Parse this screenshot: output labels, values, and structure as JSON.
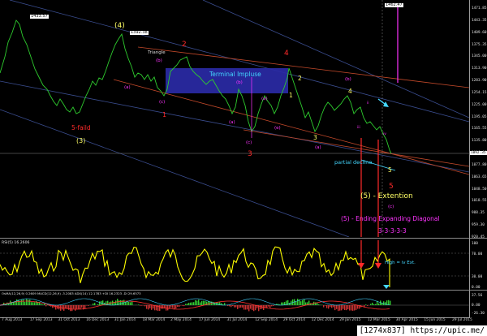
{
  "header": {
    "symbol": "GOLD,Daily",
    "ohlc": "1103.05 1106.34 1091.55 1092.35",
    "rsi_label": "RSI(5) 16.2606",
    "osc_label": "OsMA(12,26,9) 0.2609  MACD(12,26,9)  -3.2083  ADX(14) 12.1783  +DI 16.2323  -DI 29.6573"
  },
  "price_boxes": {
    "p1": "1433.57",
    "p2": "1392.38",
    "p3": "1462.47"
  },
  "annotations": {
    "triangle": "Triangle",
    "terminal": "Terminal Impluse",
    "five_failed": "5-faild",
    "three_paren": "(3)",
    "four_paren": "(4)",
    "partial_decline": "partial decline",
    "extension": "(5) -  Extention",
    "ending_diagonal": "(5) - Ending Expanding Diagonal",
    "seq": "3-3-3-3-3",
    "high_note": "High = iv Ext."
  },
  "wave_labels": {
    "a": "(a)",
    "b": "(b)",
    "c": "(c)",
    "d": "(d)",
    "e": "(e)",
    "n1": "1",
    "n2": "2",
    "n3": "3",
    "n4": "4",
    "n5": "5",
    "i": "i",
    "ii": "ii",
    "iii": "iii",
    "iv": "iv",
    "v": "v"
  },
  "price_scale": [
    "1471.85",
    "1443.35",
    "1409.60",
    "1375.35",
    "1345.00",
    "1313.90",
    "1283.90",
    "1254.15",
    "1225.00",
    "1195.05",
    "1165.55",
    "1135.80",
    "1106.60",
    "1077.80",
    "1063.65",
    "1048.50",
    "1018.55",
    "988.35",
    "959.30",
    "920.45"
  ],
  "price_current": "1092.35",
  "rsi_scale": [
    "100",
    "70.00",
    "30.00",
    "0.00"
  ],
  "osc_scale": [
    "37.56",
    "0.00",
    "-26.30"
  ],
  "dates": [
    "7 Aug 2013",
    "17 Sep 2013",
    "31 Oct 2013",
    "16 Dec 2013",
    "31 Jan 2014",
    "18 Mar 2014",
    "2 May 2014",
    "17 Jun 2014",
    "31 Jul 2014",
    "12 Sep 2014",
    "29 Oct 2014",
    "12 Dec 2014",
    "29 Jan 2015",
    "12 Mar 2015",
    "30 Apr 2015",
    "15 Jun 2015",
    "29 Jul 2015"
  ],
  "watermark": "[1274x837] https://upic.me/",
  "colors": {
    "price": "#2ecc2e",
    "rsi": "#ffff00",
    "terminal_box": "#2a2aa6",
    "magenta": "#ff33ff",
    "red": "#ff2a2a",
    "yellow": "#ffff66",
    "cyan": "#44d7ff"
  }
}
